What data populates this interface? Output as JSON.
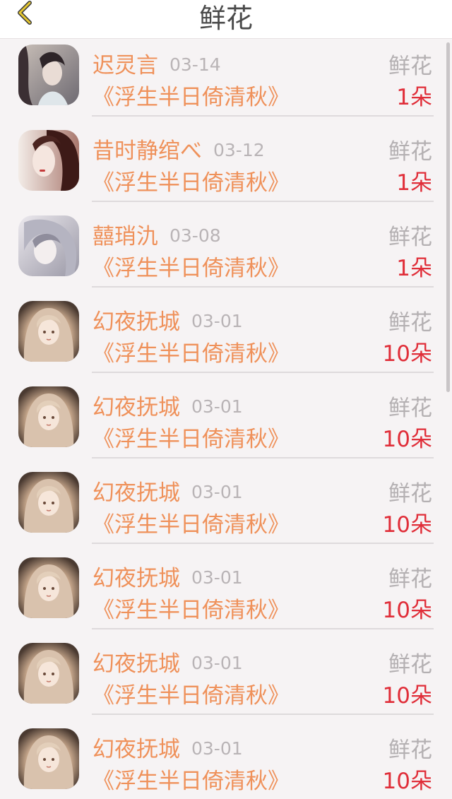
{
  "header": {
    "title": "鲜花",
    "back_icon": "chevron-left-icon"
  },
  "colors": {
    "name": "#ef915a",
    "book": "#ef915a",
    "date": "#b9b4b6",
    "gift": "#b4b0b2",
    "count": "#e02e39",
    "background": "#f6f3f4",
    "back_icon": "#e6c830"
  },
  "items": [
    {
      "name": "迟灵言",
      "date": "03-14",
      "gift": "鲜花",
      "book": "《浮生半日倚清秋》",
      "count": "1朵",
      "avatar": "avatar-1"
    },
    {
      "name": "昔时静绾べ",
      "date": "03-12",
      "gift": "鲜花",
      "book": "《浮生半日倚清秋》",
      "count": "1朵",
      "avatar": "avatar-2"
    },
    {
      "name": "囍琑氿",
      "date": "03-08",
      "gift": "鲜花",
      "book": "《浮生半日倚清秋》",
      "count": "1朵",
      "avatar": "avatar-3"
    },
    {
      "name": "幻夜抚城",
      "date": "03-01",
      "gift": "鲜花",
      "book": "《浮生半日倚清秋》",
      "count": "10朵",
      "avatar": "avatar-4"
    },
    {
      "name": "幻夜抚城",
      "date": "03-01",
      "gift": "鲜花",
      "book": "《浮生半日倚清秋》",
      "count": "10朵",
      "avatar": "avatar-4"
    },
    {
      "name": "幻夜抚城",
      "date": "03-01",
      "gift": "鲜花",
      "book": "《浮生半日倚清秋》",
      "count": "10朵",
      "avatar": "avatar-4"
    },
    {
      "name": "幻夜抚城",
      "date": "03-01",
      "gift": "鲜花",
      "book": "《浮生半日倚清秋》",
      "count": "10朵",
      "avatar": "avatar-4"
    },
    {
      "name": "幻夜抚城",
      "date": "03-01",
      "gift": "鲜花",
      "book": "《浮生半日倚清秋》",
      "count": "10朵",
      "avatar": "avatar-4"
    },
    {
      "name": "幻夜抚城",
      "date": "03-01",
      "gift": "鲜花",
      "book": "《浮生半日倚清秋》",
      "count": "10朵",
      "avatar": "avatar-4"
    }
  ]
}
